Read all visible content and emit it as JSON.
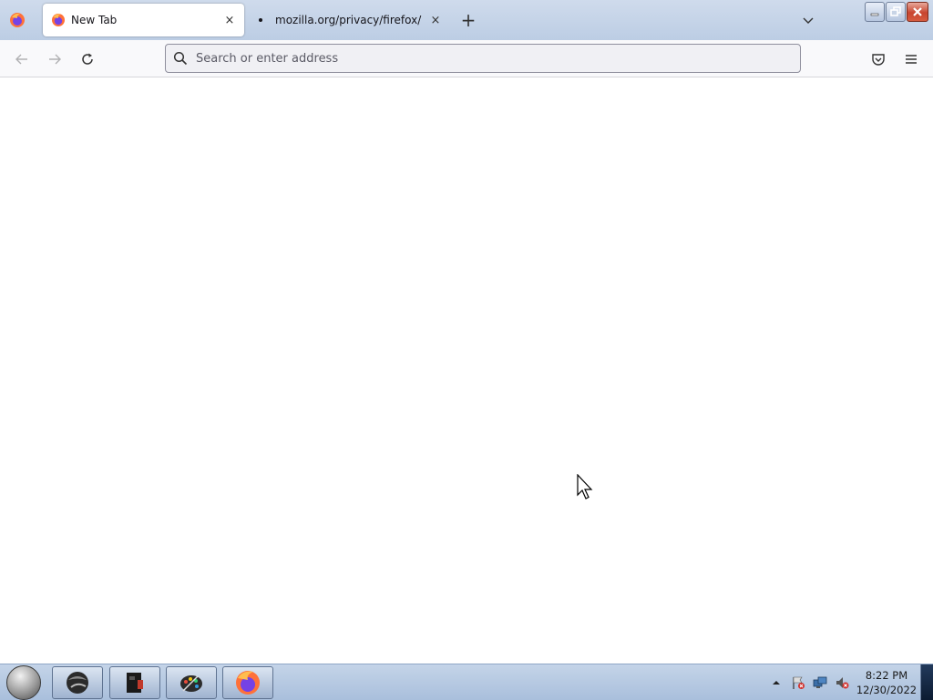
{
  "browser": {
    "tabs": [
      {
        "label": "New Tab",
        "active": true,
        "favicon": "firefox-icon",
        "close": "×"
      },
      {
        "label": "mozilla.org/privacy/firefox/",
        "active": false,
        "close": "×"
      }
    ],
    "new_tab_label": "+",
    "urlbar": {
      "placeholder": "Search or enter address",
      "value": ""
    }
  },
  "taskbar": {
    "apps": [
      {
        "name": "explorer-icon"
      },
      {
        "name": "media-icon"
      },
      {
        "name": "paint-icon"
      },
      {
        "name": "firefox-icon",
        "active": true
      }
    ],
    "tray": [
      "action-center-icon",
      "network-icon",
      "volume-icon"
    ],
    "clock": {
      "time": "8:22 PM",
      "date": "12/30/2022"
    }
  },
  "colors": {
    "firefox_orange": "#ff7139",
    "firefox_purple": "#7542e5",
    "titlebar": "#bccde4",
    "toolbar": "#f9f9fb",
    "taskbar": "#a9bfdc"
  }
}
